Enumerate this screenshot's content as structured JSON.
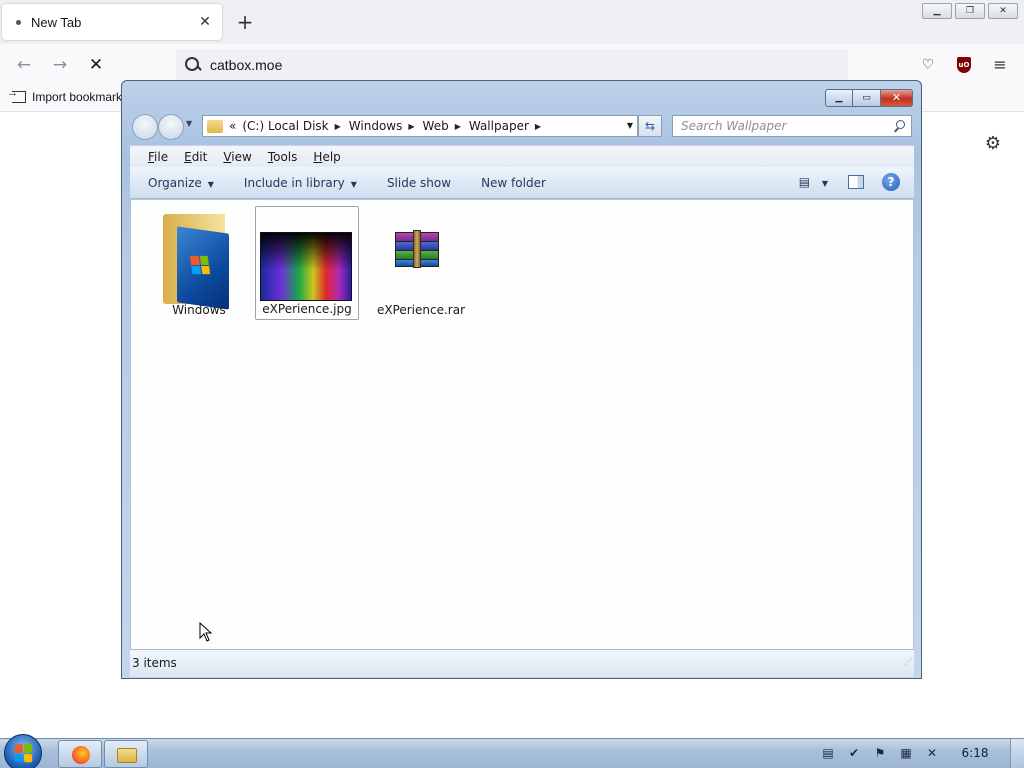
{
  "browser": {
    "tab_title": "New Tab",
    "url": "catbox.moe",
    "bookmark_label": "Import bookmarks..."
  },
  "explorer": {
    "path": [
      "(C:) Local Disk",
      "Windows",
      "Web",
      "Wallpaper"
    ],
    "search_placeholder": "Search Wallpaper",
    "menu": [
      "File",
      "Edit",
      "View",
      "Tools",
      "Help"
    ],
    "menu_hotkeys": [
      "F",
      "E",
      "V",
      "T",
      "H"
    ],
    "commands": {
      "organize": "Organize",
      "include": "Include in library",
      "slideshow": "Slide show",
      "newfolder": "New folder"
    },
    "items": [
      {
        "name": "Windows",
        "type": "folder"
      },
      {
        "name": "eXPerience.jpg",
        "type": "image"
      },
      {
        "name": "eXPerience.rar",
        "type": "archive"
      }
    ],
    "status": "3 items"
  },
  "taskbar": {
    "clock": "6:18"
  },
  "colors": {
    "accent": "#1c5eb4",
    "close_red": "#c03020"
  }
}
